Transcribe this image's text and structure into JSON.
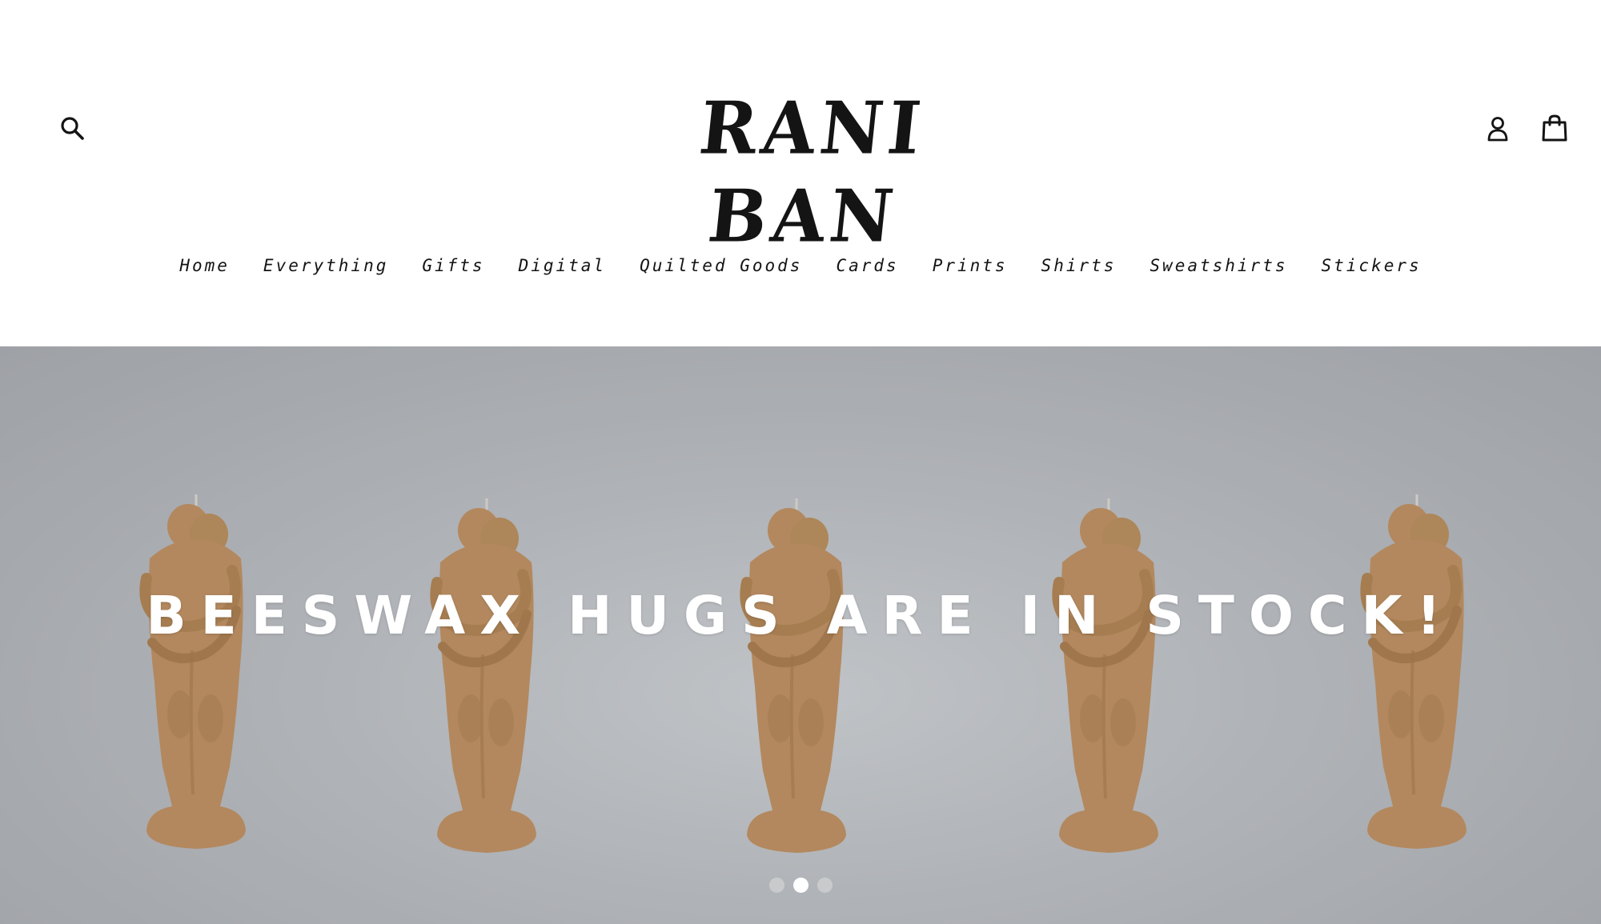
{
  "header": {
    "logo_text": "RANI BAN",
    "search_icon": "search-icon",
    "account_icon": "user-icon",
    "cart_icon": "shopping-bag-icon"
  },
  "nav": {
    "items": [
      {
        "label": "Home"
      },
      {
        "label": "Everything"
      },
      {
        "label": "Gifts"
      },
      {
        "label": "Digital"
      },
      {
        "label": "Quilted Goods"
      },
      {
        "label": "Cards"
      },
      {
        "label": "Prints"
      },
      {
        "label": "Shirts"
      },
      {
        "label": "Sweatshirts"
      },
      {
        "label": "Stickers"
      }
    ]
  },
  "hero": {
    "heading": "BEESWAX HUGS ARE IN STOCK!",
    "slides_total": 3,
    "active_slide": 2,
    "background_color": "#9ea3a7",
    "candle_color": "#b8834f"
  }
}
